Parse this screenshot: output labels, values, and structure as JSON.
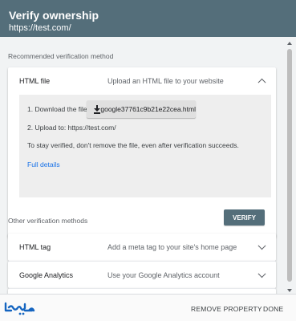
{
  "header": {
    "title": "Verify ownership",
    "subtitle": "https://test.com/"
  },
  "recommended": {
    "label": "Recommended verification method",
    "method": {
      "name": "HTML file",
      "description": "Upload an HTML file to your website",
      "step1_label": "1. Download the file:",
      "download_filename": "google37761c9b21e22cea.html",
      "step2_text": "2. Upload to: https://test.com/",
      "note": "To stay verified, don't remove the file, even after verification succeeds.",
      "details_link": "Full details",
      "verify_label": "VERIFY"
    }
  },
  "other": {
    "label": "Other verification methods",
    "methods": [
      {
        "name": "HTML tag",
        "description": "Add a meta tag to your site's home page"
      },
      {
        "name": "Google Analytics",
        "description": "Use your Google Analytics account"
      }
    ]
  },
  "footer": {
    "logo_text": "الوهيمي",
    "remove_label": "REMOVE PROPERTY",
    "done_label": "DONE"
  },
  "colors": {
    "header_bg": "#546e7a",
    "link": "#1a73e8",
    "logo": "#1565c0"
  },
  "icons": {
    "download": "download-icon",
    "expand_less": "chevron-up-icon",
    "expand_more": "chevron-down-icon"
  }
}
